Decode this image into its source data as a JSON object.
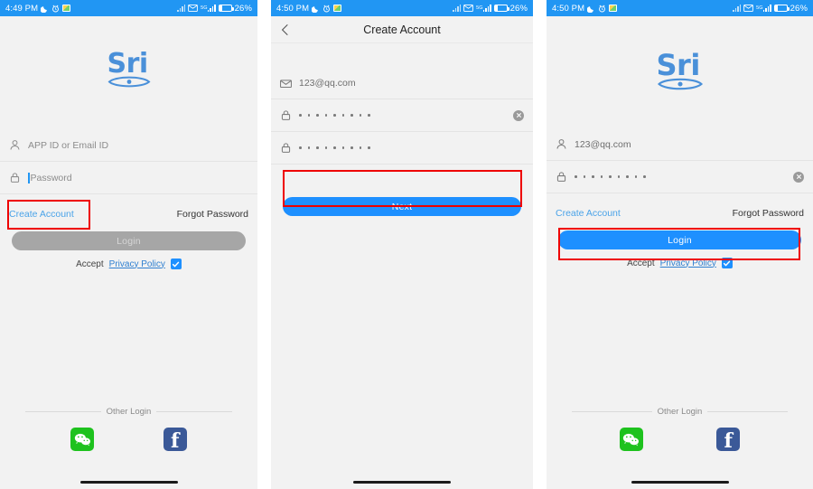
{
  "panels": [
    {
      "id": "login-initial",
      "status_bar": {
        "time": "4:49 PM",
        "battery_percent": "26%",
        "icons": [
          "moon-icon",
          "alarm-icon",
          "gallery-icon",
          "signal-bars-icon",
          "envelope-icon",
          "5g-signal-icon",
          "battery-icon"
        ]
      },
      "logo": {
        "text": "Sri"
      },
      "fields": [
        {
          "name": "app-id-field",
          "icon": "person-icon",
          "value": "",
          "placeholder": "APP ID or Email ID",
          "has_caret": false,
          "masked": false,
          "clearable": false
        },
        {
          "name": "password-field",
          "icon": "lock-icon",
          "value": "",
          "placeholder": "Password",
          "has_caret": true,
          "masked": false,
          "clearable": false
        }
      ],
      "links": {
        "create_account": "Create Account",
        "forgot_password": "Forgot Password"
      },
      "primary_button": {
        "label": "Login",
        "state": "disabled"
      },
      "accept": {
        "prefix": "Accept",
        "link": "Privacy Policy",
        "checked": true
      },
      "other_login": {
        "label": "Other Login",
        "providers": [
          "wechat-icon",
          "facebook-icon"
        ]
      },
      "highlight": "create-account-link"
    },
    {
      "id": "create-account",
      "status_bar": {
        "time": "4:50 PM",
        "battery_percent": "26%",
        "icons": [
          "moon-icon",
          "alarm-icon",
          "gallery-icon",
          "signal-bars-icon",
          "envelope-icon",
          "5g-signal-icon",
          "battery-icon"
        ]
      },
      "navbar": {
        "back": "chevron-left-icon",
        "title": "Create Account"
      },
      "fields": [
        {
          "name": "email-field",
          "icon": "envelope-icon",
          "value": "123@qq.com",
          "placeholder": "",
          "has_caret": false,
          "masked": false,
          "clearable": false
        },
        {
          "name": "password-field",
          "icon": "lock-icon",
          "value": "",
          "placeholder": "",
          "masked": true,
          "mask_count": 9,
          "clearable": true
        },
        {
          "name": "confirm-password-field",
          "icon": "lock-icon",
          "value": "",
          "placeholder": "",
          "masked": true,
          "mask_count": 9,
          "clearable": false
        }
      ],
      "primary_button": {
        "label": "Next",
        "state": "enabled"
      },
      "highlight": "next-button"
    },
    {
      "id": "login-filled",
      "status_bar": {
        "time": "4:50 PM",
        "battery_percent": "26%",
        "icons": [
          "moon-icon",
          "alarm-icon",
          "gallery-icon",
          "signal-bars-icon",
          "envelope-icon",
          "5g-signal-icon",
          "battery-icon"
        ]
      },
      "logo": {
        "text": "Sri"
      },
      "fields": [
        {
          "name": "app-id-field",
          "icon": "person-icon",
          "value": "123@qq.com",
          "placeholder": "",
          "has_caret": false,
          "masked": false,
          "clearable": false
        },
        {
          "name": "password-field",
          "icon": "lock-icon",
          "value": "",
          "placeholder": "",
          "masked": true,
          "mask_count": 9,
          "clearable": true
        }
      ],
      "links": {
        "create_account": "Create Account",
        "forgot_password": "Forgot Password"
      },
      "primary_button": {
        "label": "Login",
        "state": "enabled"
      },
      "accept": {
        "prefix": "Accept",
        "link": "Privacy Policy",
        "checked": true
      },
      "other_login": {
        "label": "Other Login",
        "providers": [
          "wechat-icon",
          "facebook-icon"
        ]
      },
      "highlight": "login-button"
    }
  ],
  "colors": {
    "status_bar_blue": "#2196f3",
    "primary_blue": "#1e90ff",
    "link_blue": "#4aa3e8",
    "logo_blue": "#4a90d9",
    "disabled_gray": "#a6a6a6",
    "screen_bg": "#f2f2f2",
    "highlight_red": "#ee0000",
    "wechat_green": "#1ec21e",
    "facebook_blue": "#3b5998"
  }
}
